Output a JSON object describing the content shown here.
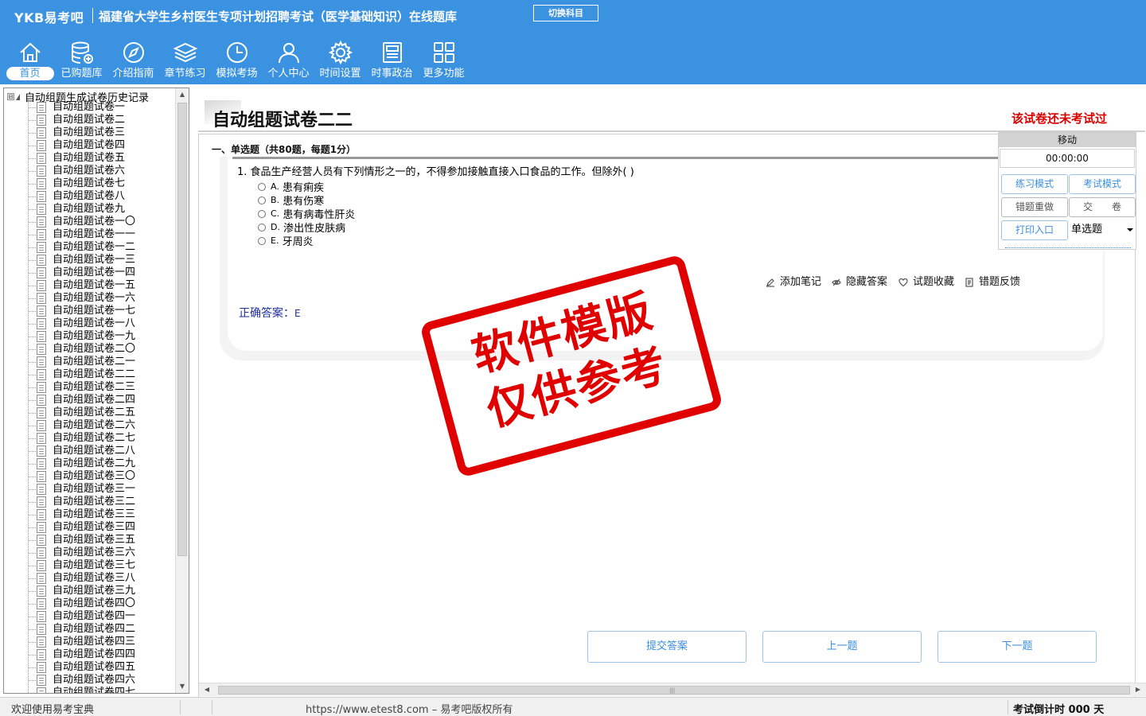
{
  "header": {
    "brand": "YKB易考吧",
    "title": "福建省大学生乡村医生专项计划招聘考试（医学基础知识）在线题库",
    "switch_label": "切换科目",
    "bg_color": "#3a92e0"
  },
  "nav": [
    {
      "label": "首页",
      "icon": "home-icon",
      "active": true
    },
    {
      "label": "已购题库",
      "icon": "database-icon"
    },
    {
      "label": "介绍指南",
      "icon": "compass-icon"
    },
    {
      "label": "章节练习",
      "icon": "layers-icon"
    },
    {
      "label": "模拟考场",
      "icon": "clock-icon"
    },
    {
      "label": "个人中心",
      "icon": "user-icon"
    },
    {
      "label": "时间设置",
      "icon": "gear-icon"
    },
    {
      "label": "时事政治",
      "icon": "newspaper-icon"
    },
    {
      "label": "更多功能",
      "icon": "grid-icon"
    }
  ],
  "sidebar": {
    "root_toggle": "⊟",
    "root_label": "自动组题生成试卷历史记录",
    "items": [
      "自动组题试卷一",
      "自动组题试卷二",
      "自动组题试卷三",
      "自动组题试卷四",
      "自动组题试卷五",
      "自动组题试卷六",
      "自动组题试卷七",
      "自动组题试卷八",
      "自动组题试卷九",
      "自动组题试卷一〇",
      "自动组题试卷一一",
      "自动组题试卷一二",
      "自动组题试卷一三",
      "自动组题试卷一四",
      "自动组题试卷一五",
      "自动组题试卷一六",
      "自动组题试卷一七",
      "自动组题试卷一八",
      "自动组题试卷一九",
      "自动组题试卷二〇",
      "自动组题试卷二一",
      "自动组题试卷二二",
      "自动组题试卷二三",
      "自动组题试卷二四",
      "自动组题试卷二五",
      "自动组题试卷二六",
      "自动组题试卷二七",
      "自动组题试卷二八",
      "自动组题试卷二九",
      "自动组题试卷三〇",
      "自动组题试卷三一",
      "自动组题试卷三二",
      "自动组题试卷三三",
      "自动组题试卷三四",
      "自动组题试卷三五",
      "自动组题试卷三六",
      "自动组题试卷三七",
      "自动组题试卷三八",
      "自动组题试卷三九",
      "自动组题试卷四〇",
      "自动组题试卷四一",
      "自动组题试卷四二",
      "自动组题试卷四三",
      "自动组题试卷四四",
      "自动组题试卷四五",
      "自动组题试卷四六",
      "自动组题试卷四七"
    ]
  },
  "paper": {
    "title": "自动组题试卷二二",
    "status": "该试卷还未考试过",
    "status_color": "#d80000"
  },
  "section": {
    "heading": "一、单选题（共80题，每题1分）"
  },
  "question": {
    "text": "1. 食品生产经营人员有下列情形之一的，不得参加接触直接入口食品的工作。但除外( )",
    "options": [
      {
        "key": "A.",
        "text": "患有痢疾"
      },
      {
        "key": "B.",
        "text": "患有伤寒"
      },
      {
        "key": "C.",
        "text": "患有病毒性肝炎"
      },
      {
        "key": "D.",
        "text": "渗出性皮肤病"
      },
      {
        "key": "E.",
        "text": "牙周炎"
      }
    ],
    "answer_label": "正确答案：",
    "answer_value": "E"
  },
  "tools": {
    "note": "添加笔记",
    "hide": "隐藏答案",
    "favorite": "试题收藏",
    "feedback": "错题反馈"
  },
  "stamp": {
    "line1": "软件模版",
    "line2": "仅供参考",
    "color": "#e00000"
  },
  "control": {
    "head": "移动",
    "timer": "00:00:00",
    "practice": "练习模式",
    "exam": "考试模式",
    "redo": "错题重做",
    "submit": "交　　卷",
    "print": "打印入口",
    "type_selected": "单选题"
  },
  "buttons": {
    "submit_answer": "提交答案",
    "prev": "上一题",
    "next": "下一题"
  },
  "status": {
    "welcome": "欢迎使用易考宝典",
    "copyright": "https://www.etest8.com – 易考吧版权所有",
    "countdown": "考试倒计时 000 天"
  }
}
